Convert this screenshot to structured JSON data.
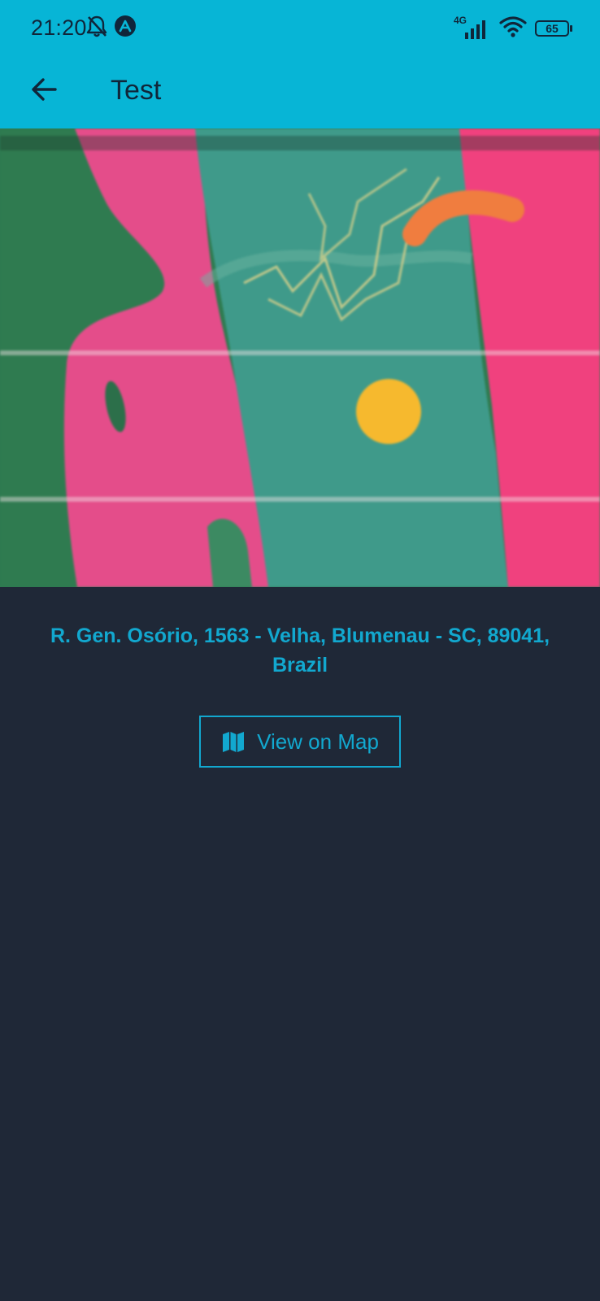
{
  "status_bar": {
    "time": "21:20",
    "network": "4G",
    "battery": "65"
  },
  "app_bar": {
    "title": "Test"
  },
  "photo": {
    "description_icon": "image"
  },
  "location": {
    "address": "R. Gen. Osório, 1563 - Velha, Blumenau - SC, 89041, Brazil"
  },
  "actions": {
    "view_map_label": "View on Map",
    "view_map_icon": "map-icon"
  },
  "colors": {
    "header": "#07b5d6",
    "background": "#1f2837",
    "accent": "#12a8cf",
    "header_text": "#10263a"
  }
}
